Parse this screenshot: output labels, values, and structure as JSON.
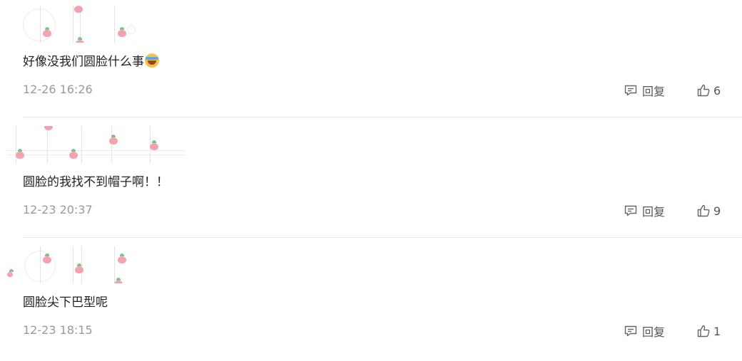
{
  "comments": [
    {
      "text": "好像没我们圆脸什么事",
      "emoji": "laughing-tears-emoji",
      "time": "12-26 16:26",
      "reply_label": "回复",
      "likes": "6"
    },
    {
      "text": "圆脸的我找不到帽子啊！！",
      "time": "12-23 20:37",
      "reply_label": "回复",
      "likes": "9"
    },
    {
      "text": "圆脸尖下巴型呢",
      "time": "12-23 18:15",
      "reply_label": "回复",
      "likes": "1"
    }
  ],
  "icons": {
    "reply": "comment-icon",
    "like": "thumbs-up-icon"
  },
  "colors": {
    "text": "#222222",
    "meta": "#9a9a9a",
    "divider": "#e6e6e6"
  }
}
